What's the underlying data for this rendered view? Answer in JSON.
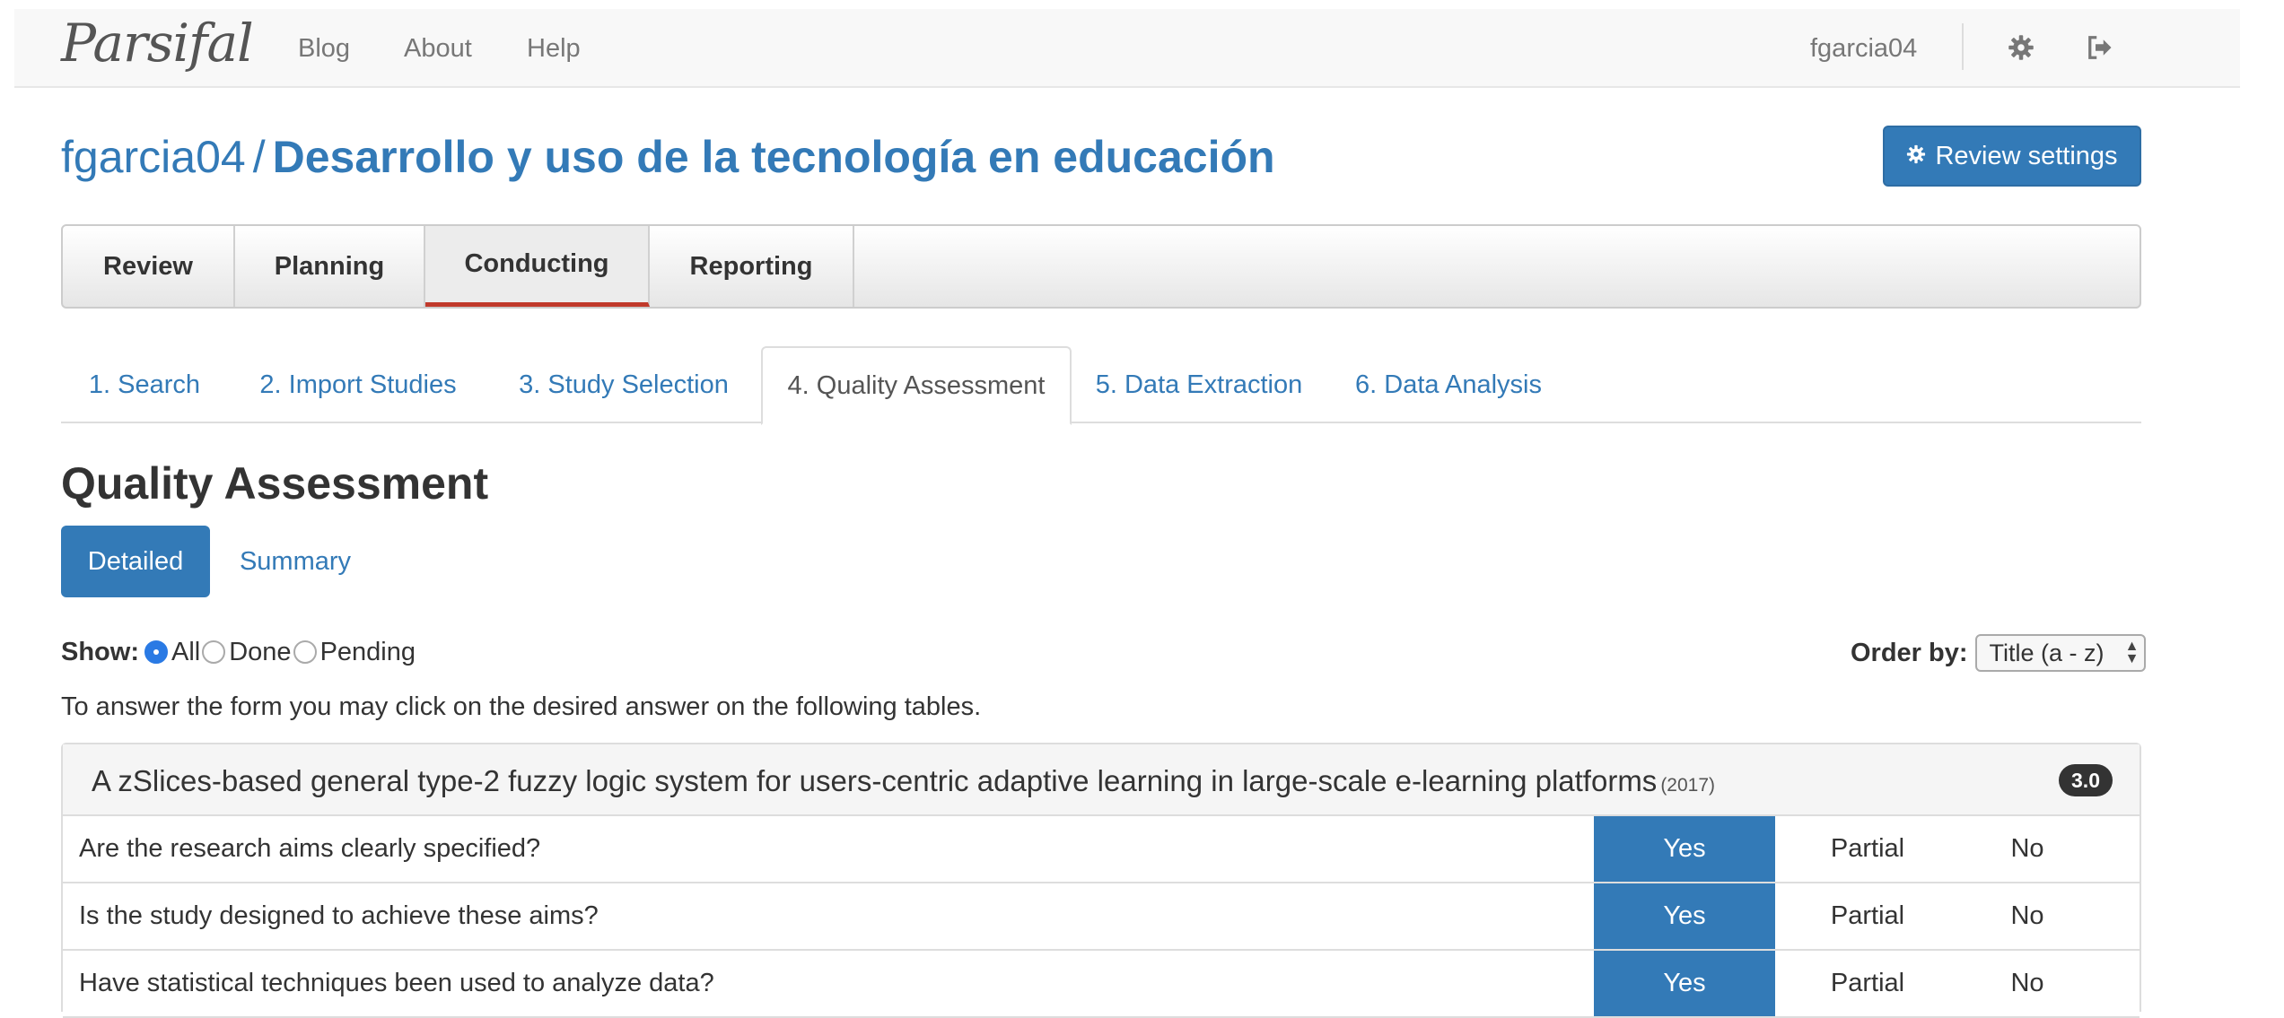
{
  "navbar": {
    "brand": "Parsifal",
    "links": [
      "Blog",
      "About",
      "Help"
    ],
    "user": "fgarcia04",
    "settings_icon": "gear-icon",
    "logout_icon": "sign-out-icon"
  },
  "header": {
    "owner": "fgarcia04",
    "separator": "/",
    "project": "Desarrollo y uso de la tecnología en educación",
    "settings_button": "Review settings"
  },
  "phase_tabs": [
    "Review",
    "Planning",
    "Conducting",
    "Reporting"
  ],
  "phase_tabs_active": "Conducting",
  "sub_tabs": [
    "1. Search",
    "2. Import Studies",
    "3. Study Selection",
    "4. Quality Assessment",
    "5. Data Extraction",
    "6. Data Analysis"
  ],
  "sub_tabs_active": "4. Quality Assessment",
  "section": {
    "title": "Quality Assessment",
    "pills": [
      "Detailed",
      "Summary"
    ],
    "pills_active": "Detailed"
  },
  "filter": {
    "show_label": "Show:",
    "options": [
      "All",
      "Done",
      "Pending"
    ],
    "selected": "All",
    "order_label": "Order by:",
    "order_value": "Title (a - z)"
  },
  "help_text": "To answer the form you may click on the desired answer on the following tables.",
  "study": {
    "title": "A zSlices-based general type-2 fuzzy logic system for users-centric adaptive learning in large-scale e-learning platforms",
    "year": "(2017)",
    "score": "3.0",
    "answers": [
      "Yes",
      "Partial",
      "No"
    ],
    "questions": [
      {
        "text": "Are the research aims clearly specified?",
        "selected": "Yes"
      },
      {
        "text": "Is the study designed to achieve these aims?",
        "selected": "Yes"
      },
      {
        "text": "Have statistical techniques been used to analyze data?",
        "selected": "Yes"
      }
    ]
  },
  "colors": {
    "primary": "#337ab7",
    "active_tab_underline": "#c0392b",
    "navbar_bg": "#f8f8f8",
    "badge_bg": "#333333"
  }
}
